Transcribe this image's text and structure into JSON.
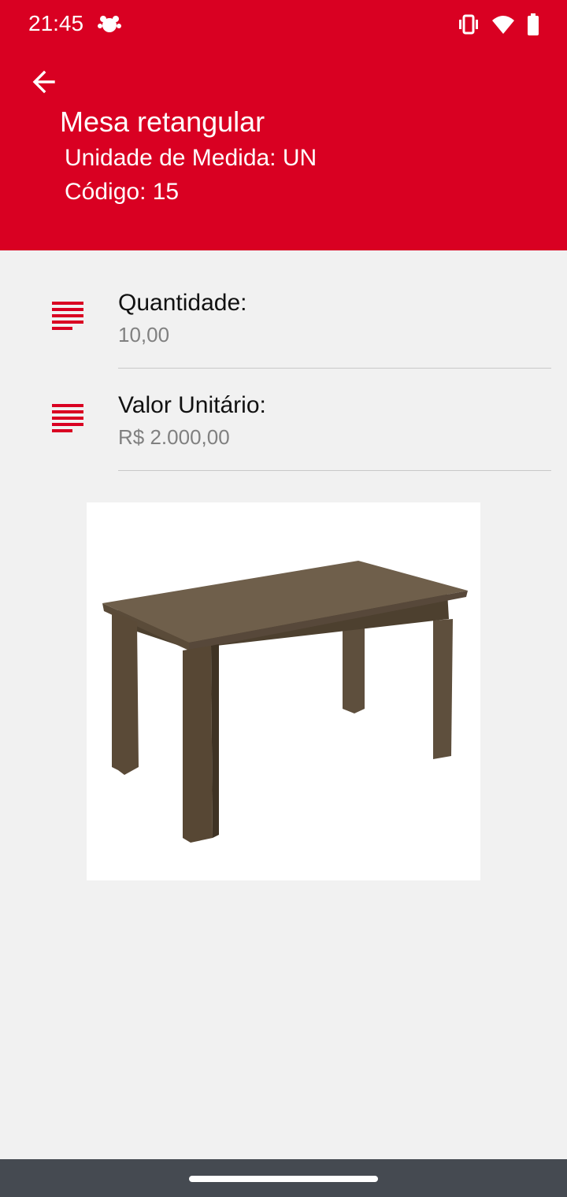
{
  "status_bar": {
    "time": "21:45"
  },
  "header": {
    "title": "Mesa retangular",
    "unit_line": "Unidade de Medida: UN",
    "code_line": "Código: 15"
  },
  "fields": [
    {
      "label": "Quantidade:",
      "value": "10,00",
      "icon": "notes-icon"
    },
    {
      "label": "Valor Unitário:",
      "value": "R$ 2.000,00",
      "icon": "notes-icon"
    }
  ],
  "colors": {
    "primary": "#d90022",
    "background": "#f1f1f1",
    "value_text": "#808080",
    "nav_bar": "#454a51"
  }
}
